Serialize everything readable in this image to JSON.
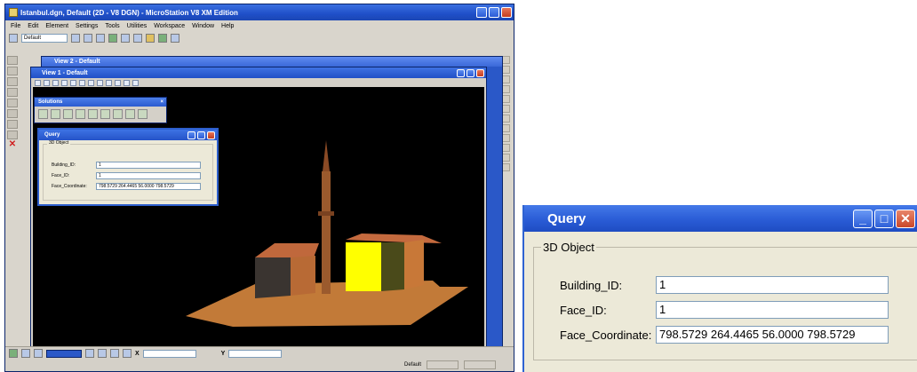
{
  "app": {
    "title": "Istanbul.dgn, Default (2D - V8 DGN) - MicroStation V8 XM Edition",
    "menu": [
      "File",
      "Edit",
      "Element",
      "Settings",
      "Tools",
      "Utilities",
      "Workspace",
      "Window",
      "Help"
    ],
    "level_select": "Default",
    "view2_title": "View 2 - Default",
    "view1_title": "View 1 - Default",
    "solutions_title": "Solutions",
    "status": {
      "level": "Default",
      "x_label": "X",
      "y_label": "Y",
      "snap": "Default"
    }
  },
  "query_small": {
    "title": "Query",
    "group_label": "3D Object",
    "fields": [
      {
        "label": "Building_ID:",
        "value": "1"
      },
      {
        "label": "Face_ID:",
        "value": "1"
      },
      {
        "label": "Face_Coordinate:",
        "value": "798.5729 264.4465 56.0000 798.5729"
      }
    ]
  },
  "query": {
    "title": "Query",
    "group_label": "3D Object",
    "fields": [
      {
        "label": "Building_ID:",
        "value": "1"
      },
      {
        "label": "Face_ID:",
        "value": "1"
      },
      {
        "label": "Face_Coordinate:",
        "value": "798.5729 264.4465 56.0000 798.5729"
      }
    ]
  },
  "colors": {
    "titlebar": "#2a5cd6",
    "dialog_bg": "#ece9d8",
    "canvas": "#000000",
    "highlight_face": "#ffff00",
    "ground": "#c8803c"
  }
}
